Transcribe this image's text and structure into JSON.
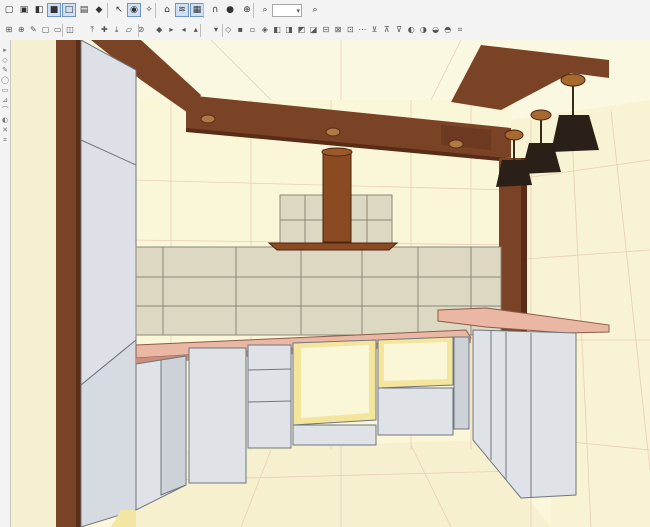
{
  "toolbar_top": {
    "buttons": [
      {
        "icon": "cube-view-icon"
      },
      {
        "icon": "cube-outline-icon"
      },
      {
        "icon": "cube-shaded-icon"
      },
      {
        "icon": "cube-solid-icon",
        "active": true
      },
      {
        "icon": "cube-wire-icon",
        "active": true
      },
      {
        "icon": "cube-texture-icon"
      },
      {
        "icon": "cube-blue-icon"
      },
      {
        "icon": "pointer-icon"
      },
      {
        "icon": "render-icon",
        "active": true
      },
      {
        "icon": "light-bulb-icon"
      },
      {
        "icon": "camera-icon"
      },
      {
        "icon": "measure-icon",
        "active": true
      },
      {
        "icon": "grid-icon",
        "active": true
      },
      {
        "icon": "magnet-icon"
      },
      {
        "icon": "stop-icon"
      },
      {
        "icon": "target-icon"
      },
      {
        "icon": "zoom-in-icon"
      },
      {
        "icon": "zoom-out-icon"
      }
    ],
    "zoom_value": ""
  },
  "toolbar_second": {
    "button_count": 36
  },
  "left_toolbar": {
    "button_count": 10
  },
  "colors": {
    "wall": "#faf6d8",
    "grid_line": "#e7c9b2",
    "beam": "#7a4326",
    "beam_dark": "#5a2c15",
    "tile": "#dcd8c2",
    "countertop": "#e9b7a3",
    "cabinet": "#dfe3e8",
    "frame_yellow": "#f4e59c",
    "lamp": "#2a2018"
  }
}
